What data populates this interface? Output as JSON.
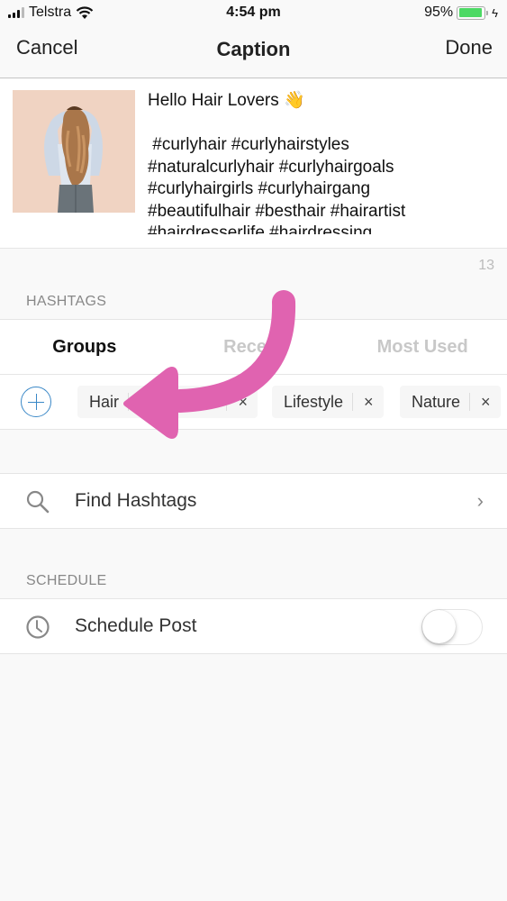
{
  "status_bar": {
    "carrier": "Telstra",
    "time": "4:54 pm",
    "battery_percent_label": "95%",
    "battery_level": 0.95,
    "charging": true
  },
  "nav": {
    "cancel_label": "Cancel",
    "title": "Caption",
    "done_label": "Done"
  },
  "caption": {
    "thumbnail_alt": "Woman with long curly hair seen from behind",
    "text": "Hello Hair Lovers 👋\n\n #curlyhair #curlyhairstyles\n#naturalcurlyhair #curlyhairgoals\n#curlyhairgirls #curlyhairgang\n#beautifulhair #besthair #hairartist\n#hairdresserlife #hairdressing",
    "char_count": "13"
  },
  "hashtags": {
    "section_title": "HASHTAGS",
    "tabs": [
      {
        "label": "Groups",
        "active": true
      },
      {
        "label": "Recent",
        "active": false
      },
      {
        "label": "Most Used",
        "active": false
      }
    ],
    "groups": [
      {
        "label": "Hair"
      },
      {
        "label": "Lifestyle"
      },
      {
        "label": "Nature"
      }
    ],
    "remove_glyph": "×",
    "find_label": "Find Hashtags"
  },
  "schedule": {
    "section_title": "SCHEDULE",
    "row_label": "Schedule Post",
    "enabled": false
  },
  "colors": {
    "accent": "#3a88c7",
    "annotation_arrow": "#e063b0",
    "battery": "#4cd964"
  }
}
